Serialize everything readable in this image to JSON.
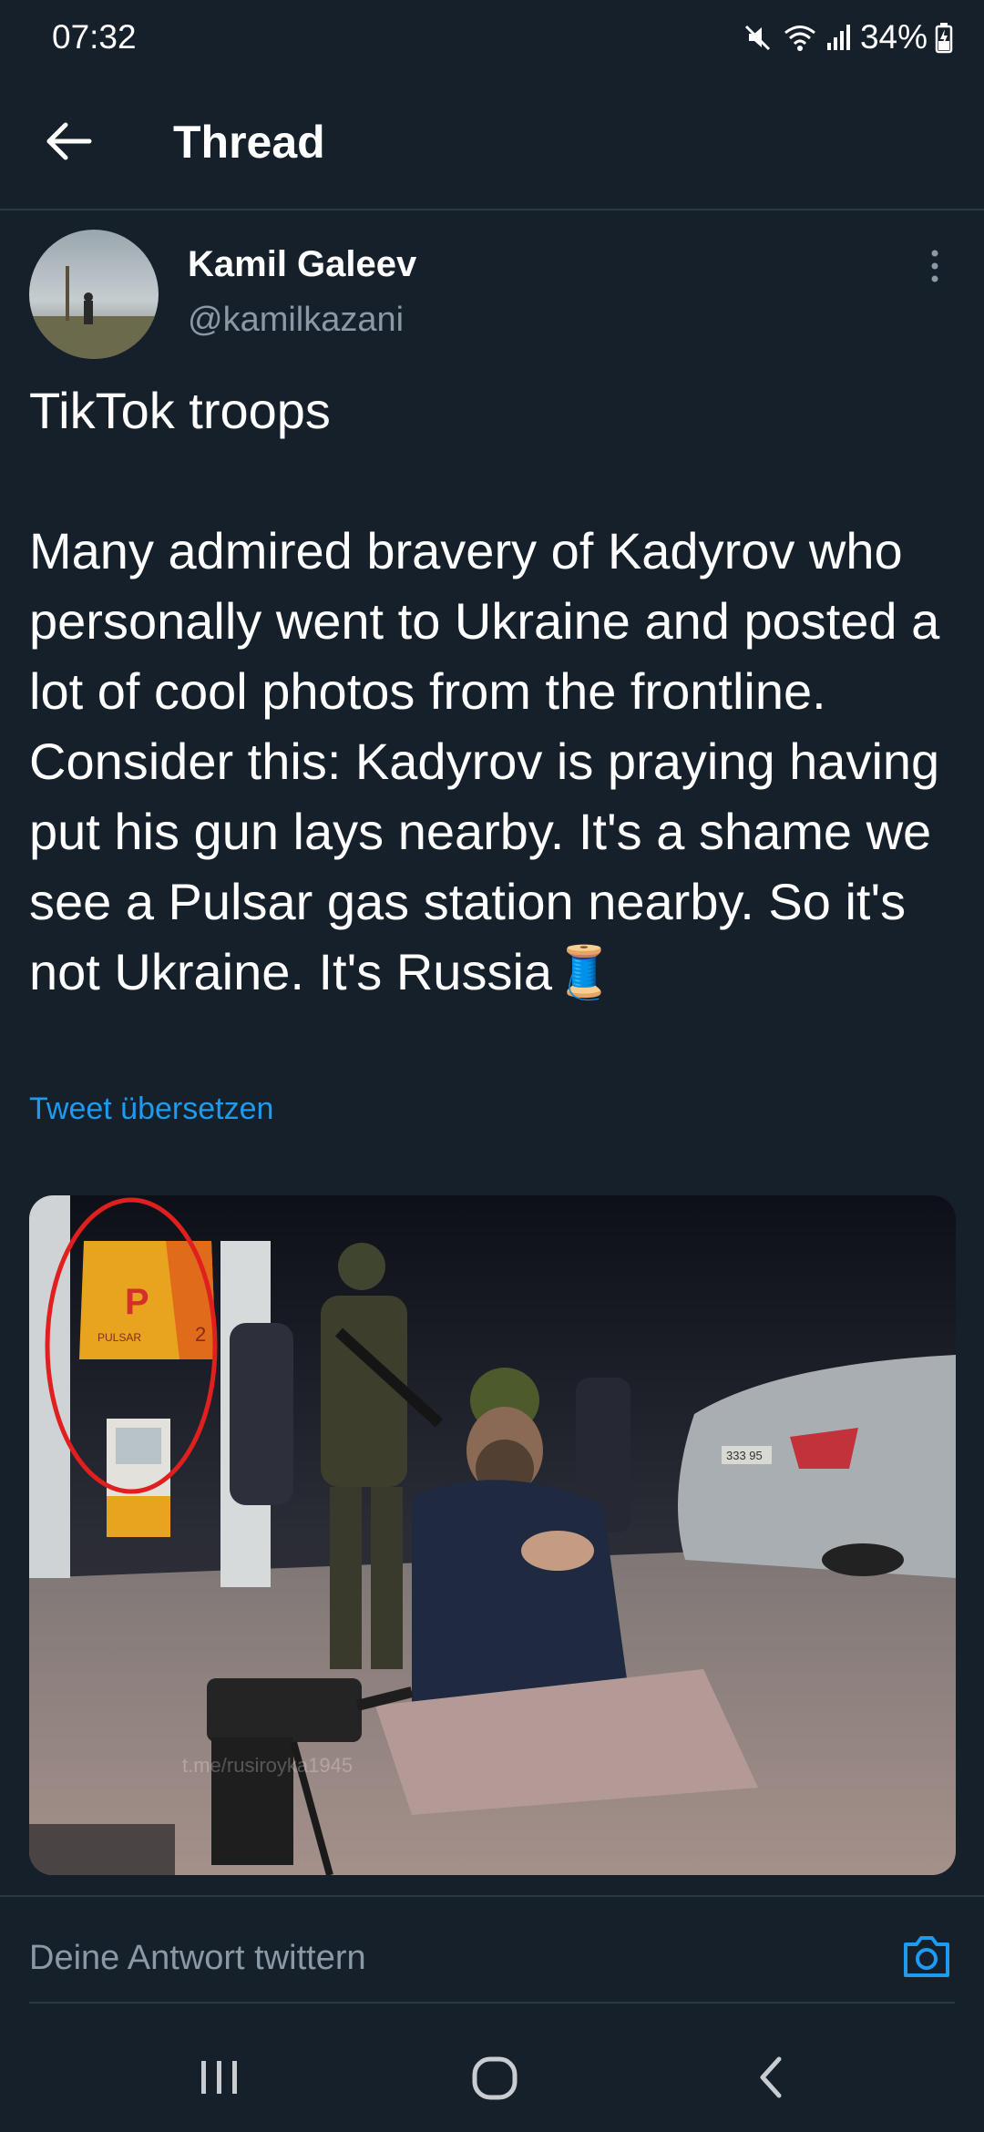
{
  "status_bar": {
    "time": "07:32",
    "battery": "34%"
  },
  "header": {
    "title": "Thread",
    "back_icon": "arrow-left-icon"
  },
  "tweet": {
    "author_name": "Kamil Galeev",
    "author_handle": "@kamilkazani",
    "text": "TikTok troops\n\nMany admired bravery of Kadyrov who personally went to Ukraine and posted a lot of cool photos from the frontline. Consider this: Kadyrov is praying having put his gun lays nearby. It's a shame we see a Pulsar gas station nearby. So it's not Ukraine. It's Russia🧵",
    "translate_label": "Tweet übersetzen",
    "media": {
      "watermark": "t.me/rusiroyka1945",
      "sign_letter": "P",
      "sign_brand": "PULSAR",
      "sign_number": "2",
      "license_plate": "333 95"
    }
  },
  "reply": {
    "placeholder": "Deine Antwort twittern",
    "camera_icon": "camera-icon"
  },
  "colors": {
    "background": "#15202b",
    "accent": "#1d9bf0",
    "secondary_text": "#8b98a5"
  }
}
